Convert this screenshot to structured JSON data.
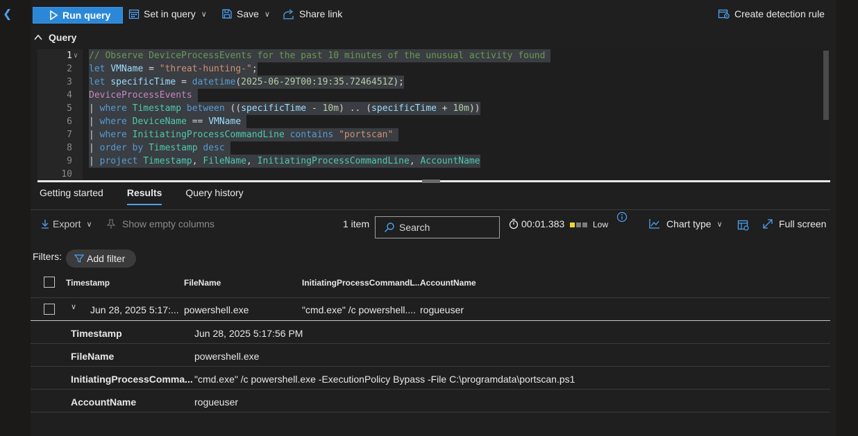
{
  "toolbar": {
    "run_label": "Run query",
    "set_in_query_label": "Set in query",
    "save_label": "Save",
    "share_label": "Share link",
    "create_rule_label": "Create detection rule"
  },
  "query_section": {
    "title": "Query"
  },
  "editor": {
    "line_numbers": [
      "1",
      "2",
      "3",
      "4",
      "5",
      "6",
      "7",
      "8",
      "9",
      "10"
    ]
  },
  "tabs": [
    "Getting started",
    "Results",
    "Query history"
  ],
  "results_toolbar": {
    "export_label": "Export",
    "show_empty_label": "Show empty columns",
    "item_count": "1 item",
    "search_placeholder": "Search",
    "duration": "00:01.383",
    "severity": "Low",
    "chart_type_label": "Chart type",
    "full_screen_label": "Full screen"
  },
  "filters": {
    "label": "Filters:",
    "add_label": "Add filter"
  },
  "table": {
    "headers": [
      "Timestamp",
      "FileName",
      "InitiatingProcessCommandL...",
      "AccountName"
    ],
    "row": {
      "timestamp": "Jun 28, 2025 5:17:...",
      "filename": "powershell.exe",
      "cmdline": "\"cmd.exe\" /c powershell....",
      "account": "rogueuser"
    }
  },
  "details": [
    {
      "key": "Timestamp",
      "value": "Jun 28, 2025 5:17:56 PM"
    },
    {
      "key": "FileName",
      "value": "powershell.exe"
    },
    {
      "key": "InitiatingProcessComma...",
      "value": "\"cmd.exe\" /c powershell.exe -ExecutionPolicy Bypass -File C:\\programdata\\portscan.ps1"
    },
    {
      "key": "AccountName",
      "value": "rogueuser"
    }
  ],
  "colors": {
    "accent": "#2b88d8",
    "severity_low": "#f2d52e"
  }
}
